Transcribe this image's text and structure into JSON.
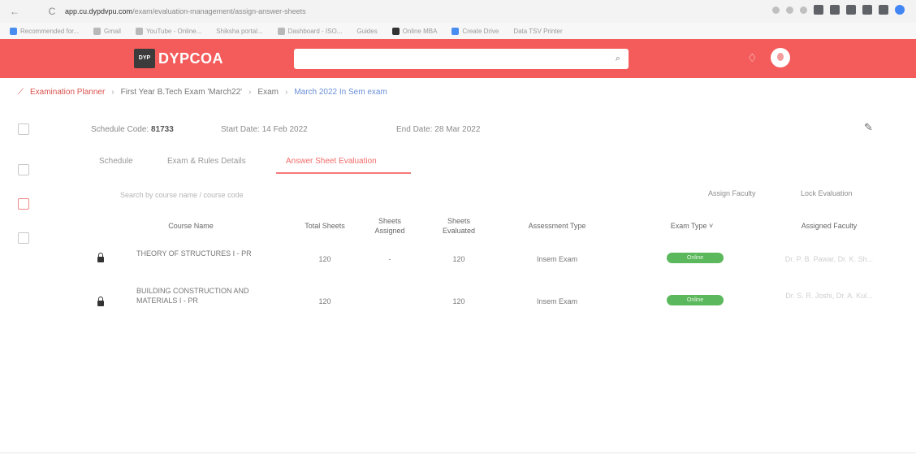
{
  "browser": {
    "back": "←",
    "reload": "C",
    "url_host": "app.cu.dypdvpu.com",
    "url_path": "/exam/evaluation-management/assign-answer-sheets",
    "bookmarks": [
      "Recommended for...",
      "Gmail",
      "YouTube - Online...",
      "Shiksha portal...",
      "Dashboard - ISO...",
      "Guides",
      "Online MBA",
      "Create Drive",
      "Data TSV Printer"
    ]
  },
  "header": {
    "logo_mark": "DYP",
    "logo_text": "DYPCOA",
    "search_placeholder": "",
    "search_icon": "search-icon",
    "bell_icon": "bell-icon"
  },
  "breadcrumb": {
    "home": "Examination Planner",
    "items": [
      "First Year B.Tech Exam 'March22'",
      "Exam",
      "March 2022 In Sem exam"
    ]
  },
  "exam": {
    "schedule_label": "Schedule Code:",
    "schedule_value": "81733",
    "start_label": "Start Date: 14 Feb 2022",
    "end_label": "End Date: 28 Mar 2022"
  },
  "tabs": [
    "Schedule",
    "Exam & Rules Details",
    "Answer Sheet Evaluation"
  ],
  "toolbar": {
    "filter_placeholder": "Search by course name / course code",
    "assign_faculty": "Assign Faculty",
    "lock_evaluation": "Lock Evaluation"
  },
  "table": {
    "headers": {
      "course": "Course Name",
      "total": "Total Sheets",
      "assigned_1": "Sheets",
      "assigned_2": "Assigned",
      "evaluated_1": "Sheets",
      "evaluated_2": "Evaluated",
      "assessment": "Assessment Type",
      "exam_type": "Exam Type ˅",
      "faculty": "Assigned Faculty"
    },
    "rows": [
      {
        "course_line1": "THEORY OF STRUCTURES I - PR",
        "course_line2": "",
        "total": "120",
        "assigned": "-",
        "evaluated": "120",
        "assessment": "Insem Exam",
        "status": "Online",
        "faculty": "Dr. P. B. Pawar, Dr. K. Sh..."
      },
      {
        "course_line1": "BUILDING CONSTRUCTION AND",
        "course_line2": "MATERIALS I - PR",
        "total": "120",
        "assigned": "",
        "evaluated": "120",
        "assessment": "Insem Exam",
        "status": "Online",
        "faculty": "Dr. S. R. Joshi, Dr. A. Kul..."
      }
    ]
  },
  "colors": {
    "header_bg": "#f45b5b",
    "tab_active": "#f26b6b",
    "status_green": "#5cb85c"
  }
}
